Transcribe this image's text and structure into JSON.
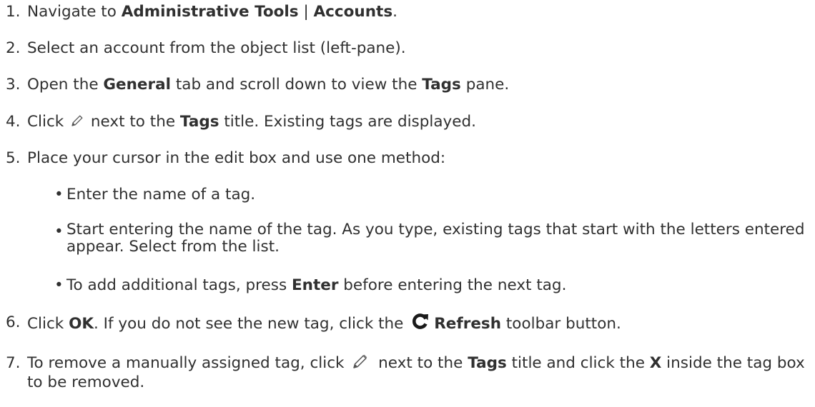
{
  "steps": [
    {
      "num": "1.",
      "parts": [
        "Navigate to ",
        "Administrative Tools",
        " | ",
        "Accounts",
        "."
      ]
    },
    {
      "num": "2.",
      "text": "Select an account from the object list (left-pane)."
    },
    {
      "num": "3.",
      "parts": [
        "Open the ",
        "General",
        " tab and scroll down to view the ",
        "Tags",
        " pane."
      ]
    },
    {
      "num": "4.",
      "parts": [
        "Click ",
        " next to the ",
        "Tags",
        " title. Existing tags are displayed."
      ]
    },
    {
      "num": "5.",
      "text": "Place your cursor in the edit box and use one method:"
    },
    {
      "num": "6.",
      "parts": [
        "Click ",
        "OK",
        ". If you do not see the new tag, click the ",
        "Refresh",
        " toolbar button."
      ]
    },
    {
      "num": "7.",
      "parts": [
        "To remove a manually assigned tag, click ",
        " next to the ",
        "Tags",
        " title and click the ",
        "X",
        " inside the tag box to be removed."
      ]
    }
  ],
  "bullets": [
    {
      "text": "Enter the name of a tag."
    },
    {
      "text": "Start entering the name of the tag. As you type, existing tags that start with the letters entered appear. Select from the list."
    },
    {
      "parts": [
        "To add additional tags, press ",
        "Enter",
        " before entering the next tag."
      ]
    }
  ],
  "bullet_glyph": "•",
  "icons": {
    "step4": "pencil-icon",
    "step6": "refresh-icon",
    "step7": "pencil-icon"
  }
}
